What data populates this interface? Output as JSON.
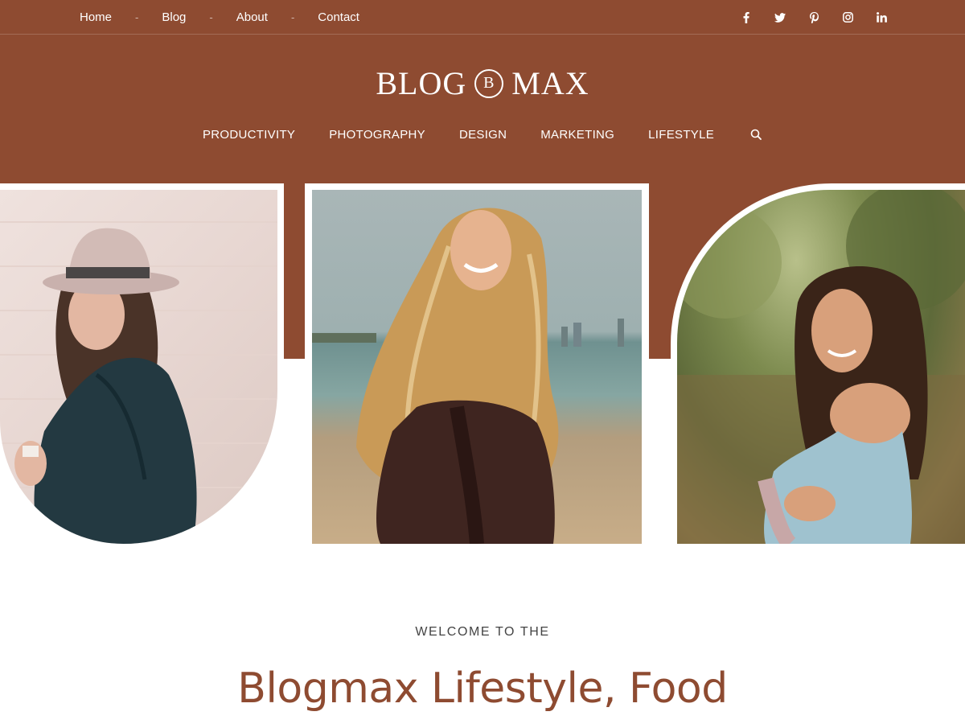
{
  "top_nav": {
    "items": [
      "Home",
      "Blog",
      "About",
      "Contact"
    ],
    "separator": "-"
  },
  "social": [
    "facebook-icon",
    "twitter-icon",
    "pinterest-icon",
    "instagram-icon",
    "linkedin-icon"
  ],
  "logo": {
    "left": "BLOG",
    "mark": "B",
    "right": "MAX"
  },
  "main_nav": {
    "items": [
      "PRODUCTIVITY",
      "PHOTOGRAPHY",
      "DESIGN",
      "MARKETING",
      "LIFESTYLE"
    ]
  },
  "hero": {
    "welcome": "WELCOME TO THE",
    "headline": "Blogmax Lifestyle, Food"
  },
  "colors": {
    "brand": "#8e4b31",
    "white": "#ffffff"
  }
}
